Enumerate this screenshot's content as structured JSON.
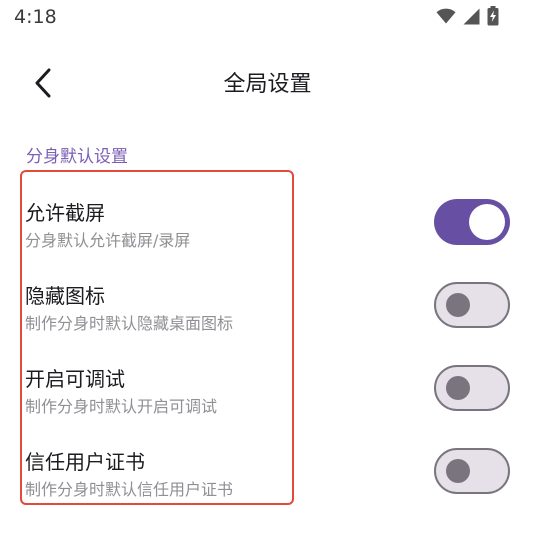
{
  "status_bar": {
    "time": "4:18",
    "icons": [
      "wifi-icon",
      "cellular-signal-icon",
      "battery-charging-icon"
    ]
  },
  "header": {
    "back_icon": "arrow-back-icon",
    "title": "全局设置"
  },
  "section": {
    "title": "分身默认设置",
    "highlight_color": "#e34a3a",
    "items": [
      {
        "title": "允许截屏",
        "subtitle": "分身默认允许截屏/录屏",
        "enabled": true
      },
      {
        "title": "隐藏图标",
        "subtitle": "制作分身时默认隐藏桌面图标",
        "enabled": false
      },
      {
        "title": "开启可调试",
        "subtitle": "制作分身时默认开启可调试",
        "enabled": false
      },
      {
        "title": "信任用户证书",
        "subtitle": "制作分身时默认信任用户证书",
        "enabled": false
      }
    ]
  },
  "colors": {
    "accent": "#6750a4",
    "section_header": "#7b5fb5",
    "switch_off_track": "#e6e0e9",
    "switch_off_outline": "#79747e"
  }
}
